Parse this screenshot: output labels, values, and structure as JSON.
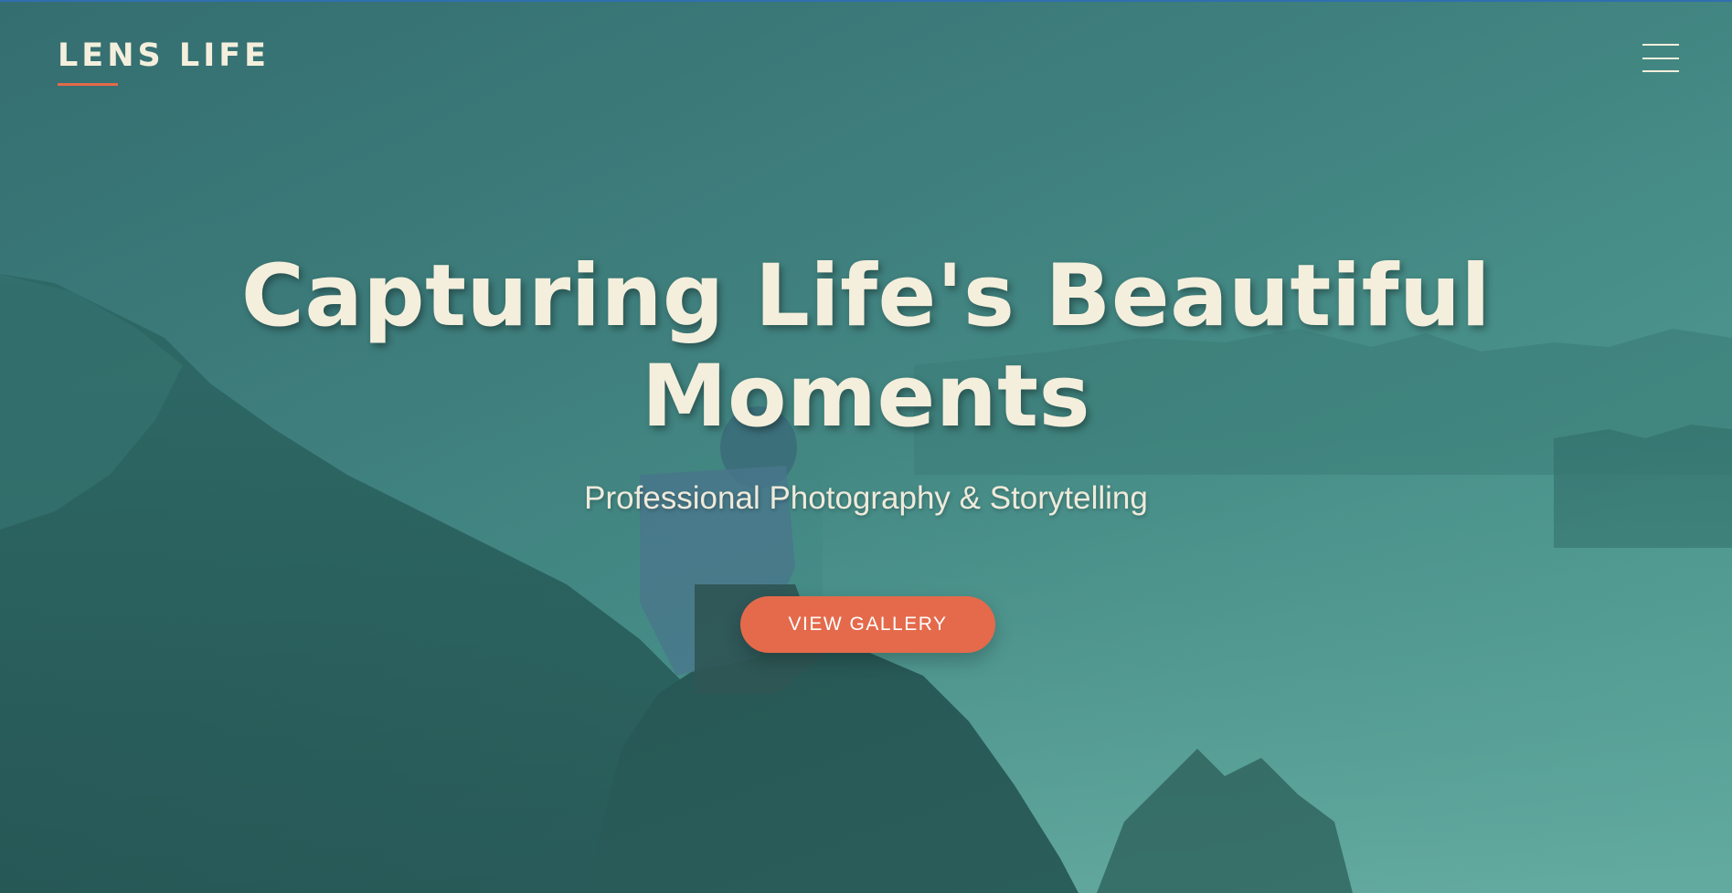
{
  "brand": {
    "logo_text": "LENS LIFE",
    "accent_color": "#e46a4b",
    "text_color": "#f4efdc"
  },
  "navbar": {
    "menu_icon": "hamburger-menu-icon"
  },
  "hero": {
    "headline_line1": "Capturing Life's Beautiful",
    "headline_line2": "Moments",
    "subtitle": "Professional Photography & Storytelling",
    "cta_label": "VIEW GALLERY",
    "background_image": "photographer-on-mountain-peak-above-fog"
  }
}
